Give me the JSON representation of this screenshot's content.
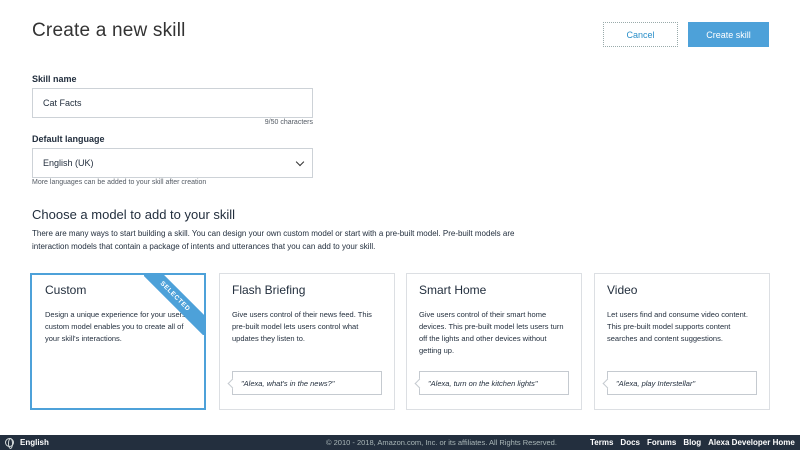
{
  "header": {
    "title": "Create a new skill",
    "cancel_label": "Cancel",
    "create_label": "Create skill"
  },
  "skill_name": {
    "label": "Skill name",
    "value": "Cat Facts",
    "counter": "9/50  characters"
  },
  "default_language": {
    "label": "Default language",
    "value": "English (UK)",
    "hint": "More languages can be added to your skill after creation"
  },
  "model_section": {
    "title": "Choose a model to add to your skill",
    "description": "There are many ways to start building a skill. You can design your own custom model or start with a pre-built model.  Pre-built models are interaction models that contain a package of intents and utterances that you can add to your skill."
  },
  "models": [
    {
      "title": "Custom",
      "description": "Design a unique experience for your users. A custom model enables you to create all of your skill's interactions.",
      "selected": true,
      "badge": "SELECTED",
      "utterance": ""
    },
    {
      "title": "Flash Briefing",
      "description": "Give users control of their news feed. This pre-built model lets users control what updates they listen to.",
      "selected": false,
      "utterance": "\"Alexa, what's in the news?\""
    },
    {
      "title": "Smart Home",
      "description": "Give users control of their smart home devices. This pre-built model lets users turn off the lights and other devices without getting up.",
      "selected": false,
      "utterance": "\"Alexa, turn on the kitchen lights\""
    },
    {
      "title": "Video",
      "description": "Let users find and consume video content. This pre-built model supports content searches and content suggestions.",
      "selected": false,
      "utterance": "\"Alexa, play Interstellar\""
    }
  ],
  "footer": {
    "language": "English",
    "copyright": "© 2010 - 2018, Amazon.com, Inc. or its affiliates. All Rights Reserved.",
    "links": [
      "Terms",
      "Docs",
      "Forums",
      "Blog",
      "Alexa Developer Home"
    ]
  },
  "colors": {
    "accent": "#4da1d9",
    "link": "#2a8fc9",
    "footer_bg": "#232f3e"
  }
}
